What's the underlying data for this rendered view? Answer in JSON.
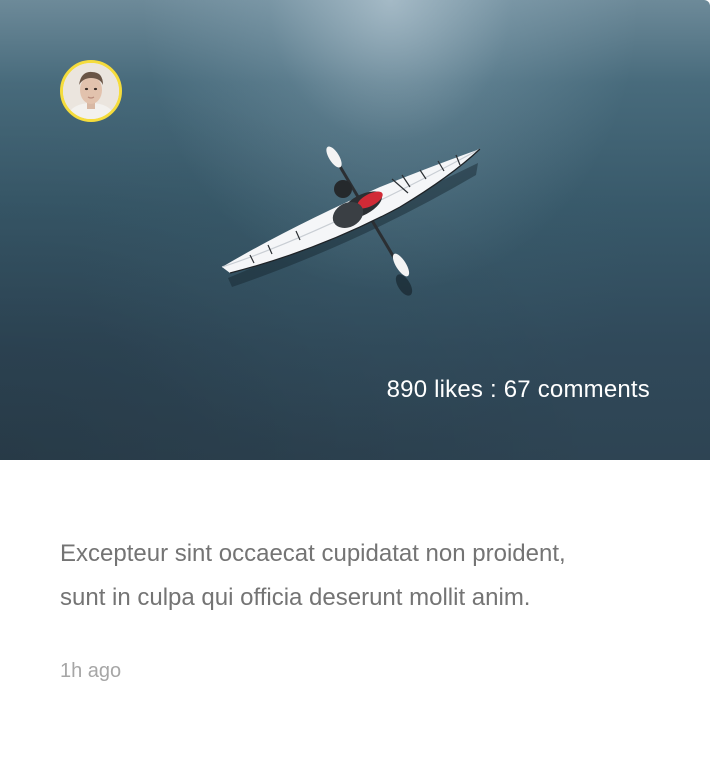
{
  "post": {
    "stats": "890 likes : 67 comments",
    "caption_line1": "Excepteur sint occaecat cupidatat non proident,",
    "caption_line2": "sunt in culpa qui officia deserunt mollit anim.",
    "timestamp": "1h ago"
  },
  "icons": {
    "avatar": "user-avatar"
  },
  "colors": {
    "avatar_ring": "#f5dc3c",
    "caption_text": "#747474",
    "timestamp_text": "#a6a6a6",
    "stats_text": "#ffffff"
  }
}
